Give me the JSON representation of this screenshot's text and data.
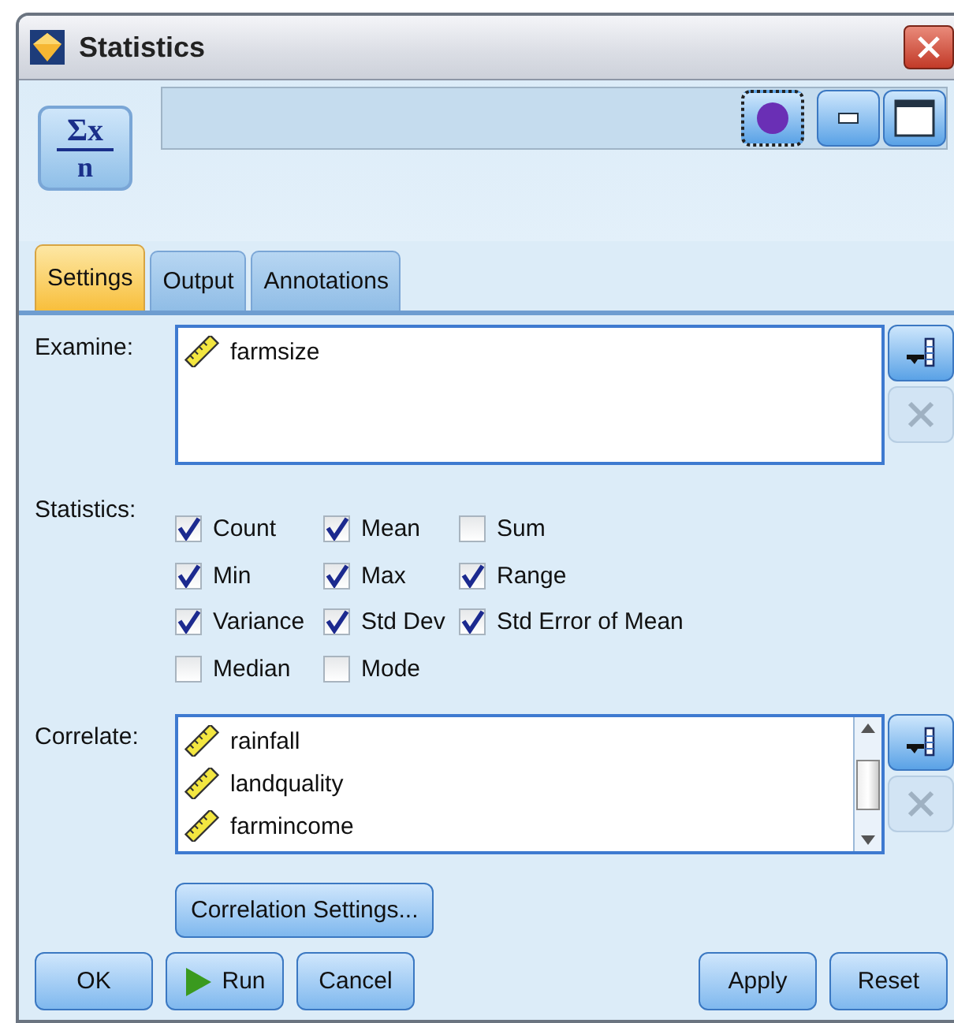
{
  "window": {
    "title": "Statistics"
  },
  "node_icon": {
    "numerator": "Σx",
    "denominator": "n"
  },
  "tabs": [
    {
      "label": "Settings",
      "selected": true
    },
    {
      "label": "Output",
      "selected": false
    },
    {
      "label": "Annotations",
      "selected": false
    }
  ],
  "examine": {
    "label": "Examine:",
    "fields": [
      "farmsize"
    ]
  },
  "statistics": {
    "label": "Statistics:",
    "options": [
      {
        "label": "Count",
        "checked": true
      },
      {
        "label": "Mean",
        "checked": true
      },
      {
        "label": "Sum",
        "checked": false
      },
      {
        "label": "Min",
        "checked": true
      },
      {
        "label": "Max",
        "checked": true
      },
      {
        "label": "Range",
        "checked": true
      },
      {
        "label": "Variance",
        "checked": true
      },
      {
        "label": "Std Dev",
        "checked": true
      },
      {
        "label": "Std Error of Mean",
        "checked": true
      },
      {
        "label": "Median",
        "checked": false
      },
      {
        "label": "Mode",
        "checked": false
      }
    ]
  },
  "correlate": {
    "label": "Correlate:",
    "fields": [
      "rainfall",
      "landquality",
      "farmincome"
    ]
  },
  "correlation_settings": "Correlation Settings...",
  "buttons_left": [
    {
      "label": "OK",
      "kind": "plain"
    },
    {
      "label": "Run",
      "kind": "run"
    },
    {
      "label": "Cancel",
      "kind": "plain"
    }
  ],
  "buttons_right": [
    {
      "label": "Apply"
    },
    {
      "label": "Reset"
    }
  ]
}
